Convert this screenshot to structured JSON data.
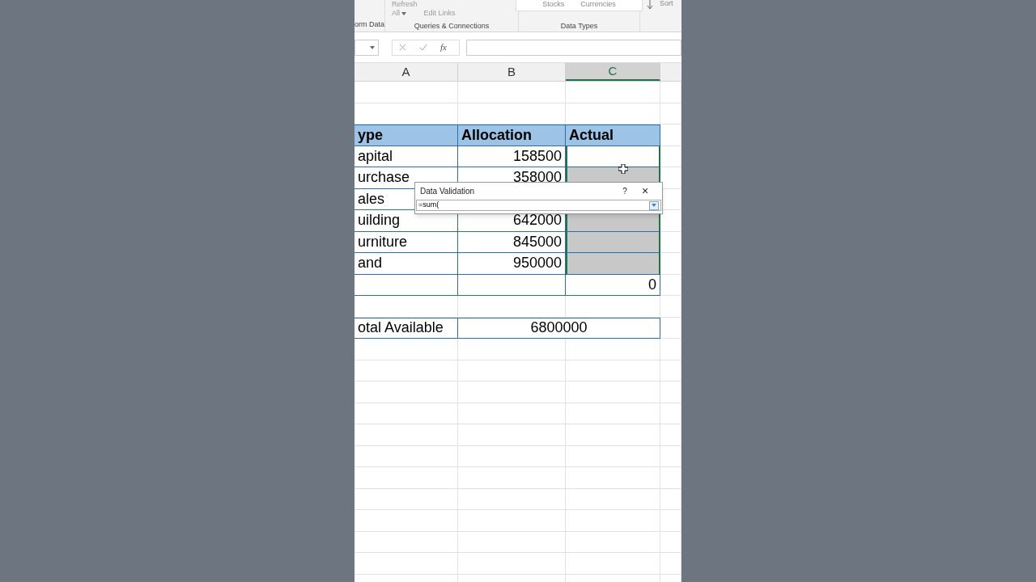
{
  "ribbon": {
    "refresh": "Refresh",
    "all": "All",
    "edit_links": "Edit Links",
    "groups": [
      "orm Data",
      "Queries & Connections",
      "Data Types"
    ],
    "data_types": [
      "Stocks",
      "Currencies"
    ],
    "sort": "Sort"
  },
  "formula_bar": {
    "fx": "fx"
  },
  "columns": [
    {
      "label": "A",
      "selected": false
    },
    {
      "label": "B",
      "selected": false
    },
    {
      "label": "C",
      "selected": true
    }
  ],
  "rows": [
    {
      "kind": "blank"
    },
    {
      "kind": "blank"
    },
    {
      "kind": "header",
      "cells": [
        "ype",
        "Allocation",
        "Actual"
      ]
    },
    {
      "kind": "item",
      "label": "apital",
      "allocation": "158500",
      "selected": false
    },
    {
      "kind": "item",
      "label": "urchase",
      "allocation": "358000",
      "selected": true
    },
    {
      "kind": "item",
      "label": "ales"
    },
    {
      "kind": "item",
      "label": "uilding",
      "allocation": "642000",
      "selected": true
    },
    {
      "kind": "item",
      "label": "urniture",
      "allocation": "845000",
      "selected": true
    },
    {
      "kind": "item",
      "label": "and",
      "allocation": "950000",
      "selected": true
    },
    {
      "kind": "total",
      "actual": "0"
    },
    {
      "kind": "blank"
    },
    {
      "kind": "available",
      "label": "otal Available",
      "value": "6800000"
    },
    {
      "kind": "blank"
    },
    {
      "kind": "blank"
    },
    {
      "kind": "blank"
    },
    {
      "kind": "blank"
    },
    {
      "kind": "blank"
    },
    {
      "kind": "blank"
    },
    {
      "kind": "blank"
    },
    {
      "kind": "blank"
    },
    {
      "kind": "blank"
    },
    {
      "kind": "blank"
    },
    {
      "kind": "blank"
    },
    {
      "kind": "blank"
    }
  ],
  "dialog": {
    "title": "Data Validation",
    "help": "?",
    "close": "×",
    "value": "=sum("
  }
}
